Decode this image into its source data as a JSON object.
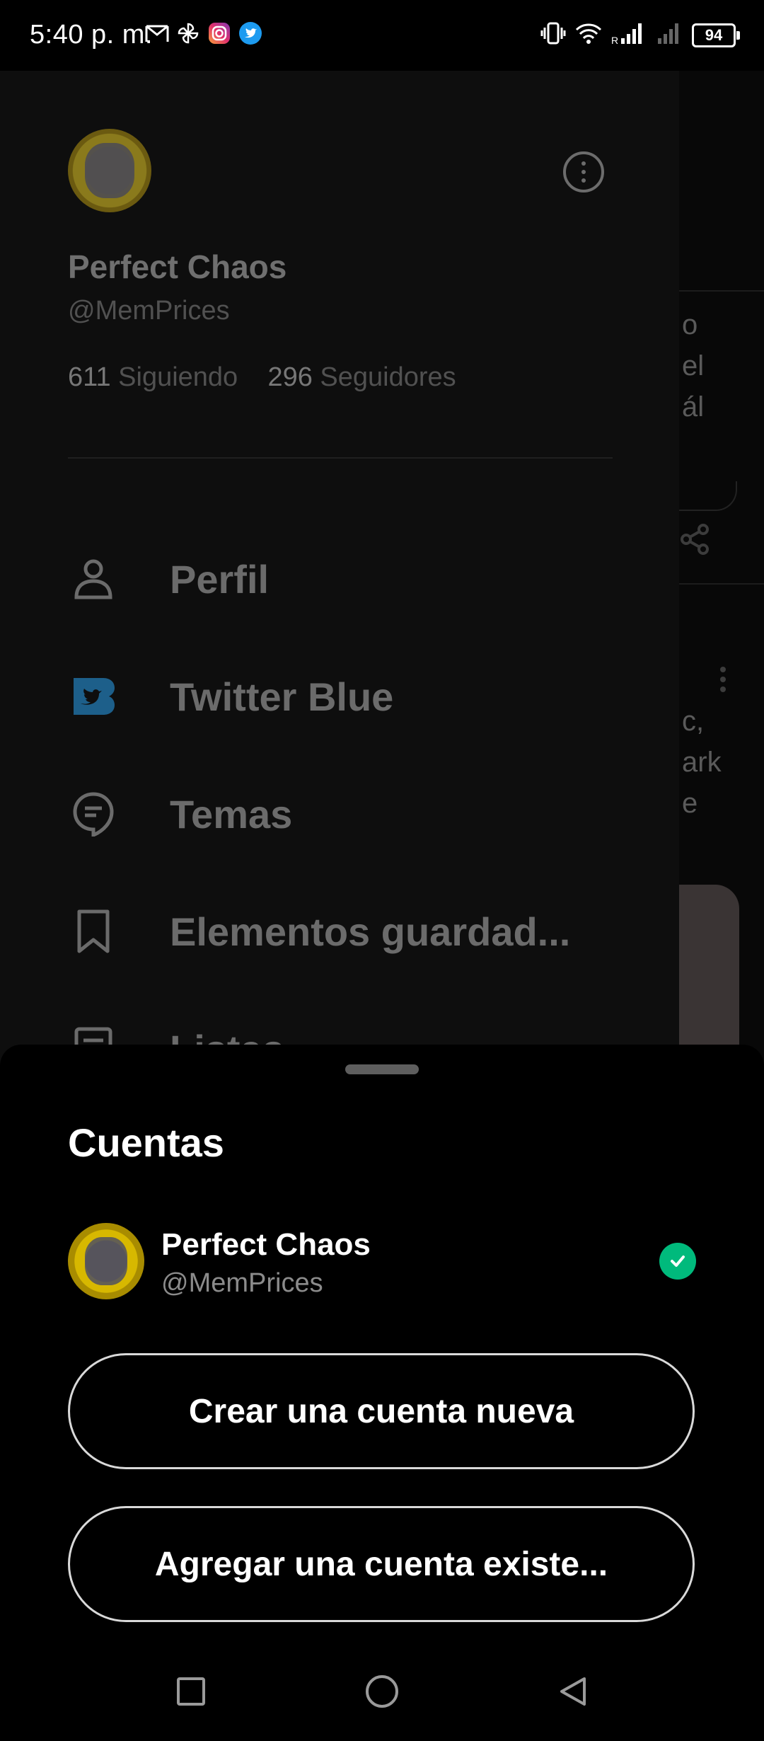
{
  "status_bar": {
    "time": "5:40 p. m.",
    "battery": "94",
    "left_icons": [
      "gmail-icon",
      "pinwheel-icon",
      "instagram-icon",
      "twitter-icon"
    ],
    "right_icons": [
      "vibrate-icon",
      "wifi-icon",
      "signal-icon",
      "signal-icon"
    ]
  },
  "drawer": {
    "profile_name": "Perfect Chaos",
    "profile_handle": "@MemPrices",
    "following_count": "611",
    "following_label": "Siguiendo",
    "followers_count": "296",
    "followers_label": "Seguidores",
    "menu": [
      {
        "label": "Perfil",
        "icon": "person-icon"
      },
      {
        "label": "Twitter Blue",
        "icon": "twitter-blue-icon"
      },
      {
        "label": "Temas",
        "icon": "topics-icon"
      },
      {
        "label": "Elementos guardad...",
        "icon": "bookmark-icon"
      },
      {
        "label": "Listas",
        "icon": "lists-icon"
      }
    ]
  },
  "background_peek": {
    "lines_top": [
      "o",
      "el",
      "ál"
    ],
    "lines_mid": [
      "c,",
      "ark",
      "e"
    ]
  },
  "sheet": {
    "title": "Cuentas",
    "account": {
      "name": "Perfect Chaos",
      "handle": "@MemPrices"
    },
    "create_button": "Crear una cuenta nueva",
    "add_button": "Agregar una cuenta existe..."
  },
  "colors": {
    "twitter_blue": "#1d9bf0",
    "check_green": "#00ba7c",
    "sheet_bg": "#000000"
  }
}
